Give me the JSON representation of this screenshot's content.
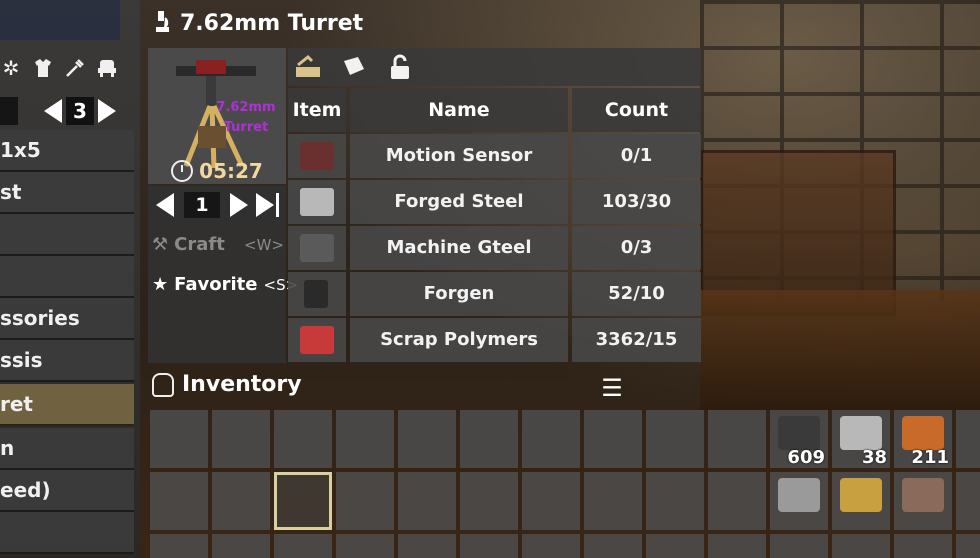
{
  "title": "7.62mm Turret",
  "sidebar": {
    "page": "3",
    "items": [
      {
        "label": "1x5",
        "selected": false
      },
      {
        "label": "st",
        "selected": false
      },
      {
        "label": "",
        "selected": false
      },
      {
        "label": "",
        "selected": false
      },
      {
        "label": "ssories",
        "selected": false
      },
      {
        "label": "ssis",
        "selected": false
      },
      {
        "label": "ret",
        "selected": true
      },
      {
        "label": "n",
        "selected": false
      },
      {
        "label": "eed)",
        "selected": false
      },
      {
        "label": "",
        "selected": false
      }
    ]
  },
  "recipe": {
    "preview_label": "7.62mm Turret",
    "craft_time": "05:27",
    "quantity": "1",
    "craft_label": "Craft",
    "craft_key": "<W>",
    "favorite_label": "Favorite",
    "favorite_key": "<S>"
  },
  "table": {
    "headers": {
      "item": "Item",
      "name": "Name",
      "count": "Count"
    },
    "rows": [
      {
        "name": "Motion Sensor",
        "count": "0/1",
        "icon": "motion-sensor-icon"
      },
      {
        "name": "Forged Steel",
        "count": "103/30",
        "icon": "forged-steel-icon"
      },
      {
        "name": "Machine Gteel",
        "count": "0/3",
        "icon": "machine-gun-parts-icon"
      },
      {
        "name": "Forgen",
        "count": "52/10",
        "icon": "forged-item-icon"
      },
      {
        "name": "Scrap Polymers",
        "count": "3362/15",
        "icon": "scrap-polymers-icon"
      }
    ]
  },
  "inventory": {
    "title": "Inventory",
    "stacks": [
      {
        "count": "609",
        "icon": "ammo-bundle-icon"
      },
      {
        "count": "38",
        "icon": "duct-tape-icon"
      },
      {
        "count": "211",
        "icon": "explosive-icon"
      }
    ]
  }
}
